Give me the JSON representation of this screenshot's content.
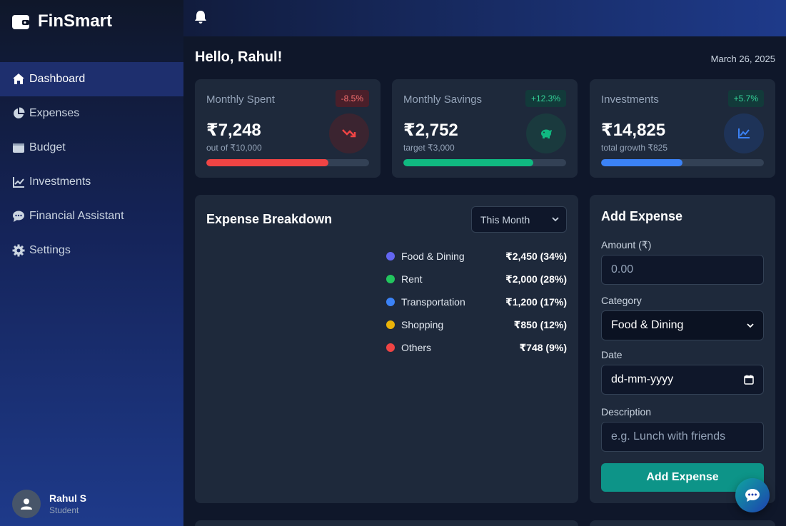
{
  "app": {
    "name": "FinSmart"
  },
  "sidebar": {
    "items": [
      {
        "label": "Dashboard",
        "icon": "home-icon",
        "active": true
      },
      {
        "label": "Expenses",
        "icon": "pie-chart-icon",
        "active": false
      },
      {
        "label": "Budget",
        "icon": "wallet-icon",
        "active": false
      },
      {
        "label": "Investments",
        "icon": "line-chart-icon",
        "active": false
      },
      {
        "label": "Financial Assistant",
        "icon": "comment-dots-icon",
        "active": false
      },
      {
        "label": "Settings",
        "icon": "gear-icon",
        "active": false
      }
    ],
    "user": {
      "name": "Rahul S",
      "role": "Student"
    }
  },
  "header": {
    "greeting": "Hello, Rahul!",
    "date": "March 26, 2025"
  },
  "stats": [
    {
      "title": "Monthly Spent",
      "badge": "-8.5%",
      "value": "₹7,248",
      "sub": "out of ₹10,000",
      "progress": 0.75,
      "color": "#ef4444",
      "icon": "trend-down-icon"
    },
    {
      "title": "Monthly Savings",
      "badge": "+12.3%",
      "value": "₹2,752",
      "sub": "target ₹3,000",
      "progress": 0.8,
      "color": "#10b981",
      "icon": "piggy-bank-icon"
    },
    {
      "title": "Investments",
      "badge": "+5.7%",
      "value": "₹14,825",
      "sub": "total growth ₹825",
      "progress": 0.5,
      "color": "#3b82f6",
      "icon": "chart-line-icon"
    }
  ],
  "breakdown": {
    "title": "Expense Breakdown",
    "period": "This Month",
    "items": [
      {
        "label": "Food & Dining",
        "value": "₹2,450 (34%)",
        "color": "#6366f1"
      },
      {
        "label": "Rent",
        "value": "₹2,000 (28%)",
        "color": "#22c55e"
      },
      {
        "label": "Transportation",
        "value": "₹1,200 (17%)",
        "color": "#3b82f6"
      },
      {
        "label": "Shopping",
        "value": "₹850 (12%)",
        "color": "#eab308"
      },
      {
        "label": "Others",
        "value": "₹748 (9%)",
        "color": "#ef4444"
      }
    ]
  },
  "add_expense": {
    "title": "Add Expense",
    "amount_label": "Amount (₹)",
    "amount_placeholder": "0.00",
    "category_label": "Category",
    "category_value": "Food & Dining",
    "date_label": "Date",
    "date_placeholder": "dd-mm-yyyy",
    "description_label": "Description",
    "description_placeholder": "e.g. Lunch with friends",
    "submit_label": "Add Expense"
  }
}
